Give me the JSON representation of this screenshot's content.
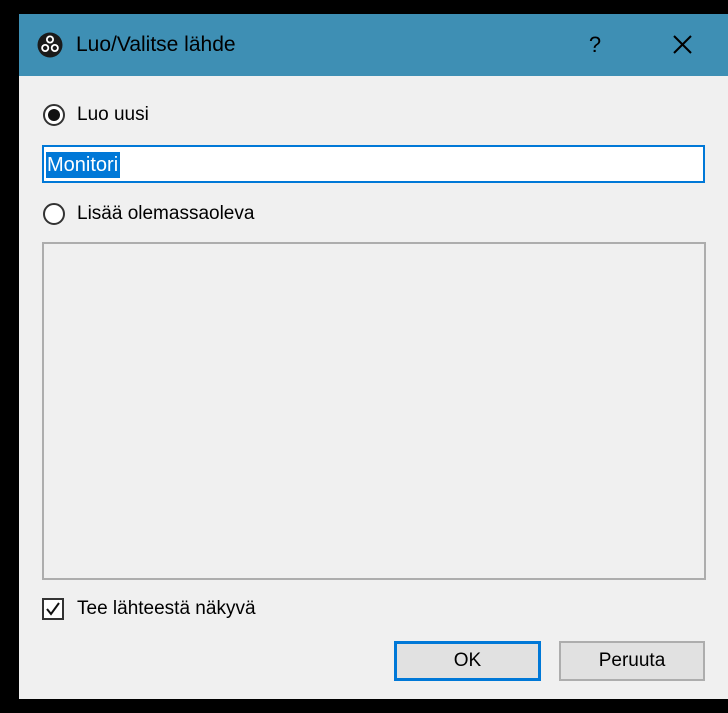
{
  "window": {
    "title": "Luo/Valitse lähde",
    "help_label": "?",
    "accent_color": "#3e8fb4"
  },
  "create_new": {
    "label": "Luo uusi",
    "selected": true,
    "value": "Monitori"
  },
  "add_existing": {
    "label": "Lisää olemassaoleva",
    "selected": false,
    "items": []
  },
  "make_visible": {
    "label": "Tee lähteestä näkyvä",
    "checked": true
  },
  "buttons": {
    "ok_label": "OK",
    "cancel_label": "Peruuta"
  }
}
